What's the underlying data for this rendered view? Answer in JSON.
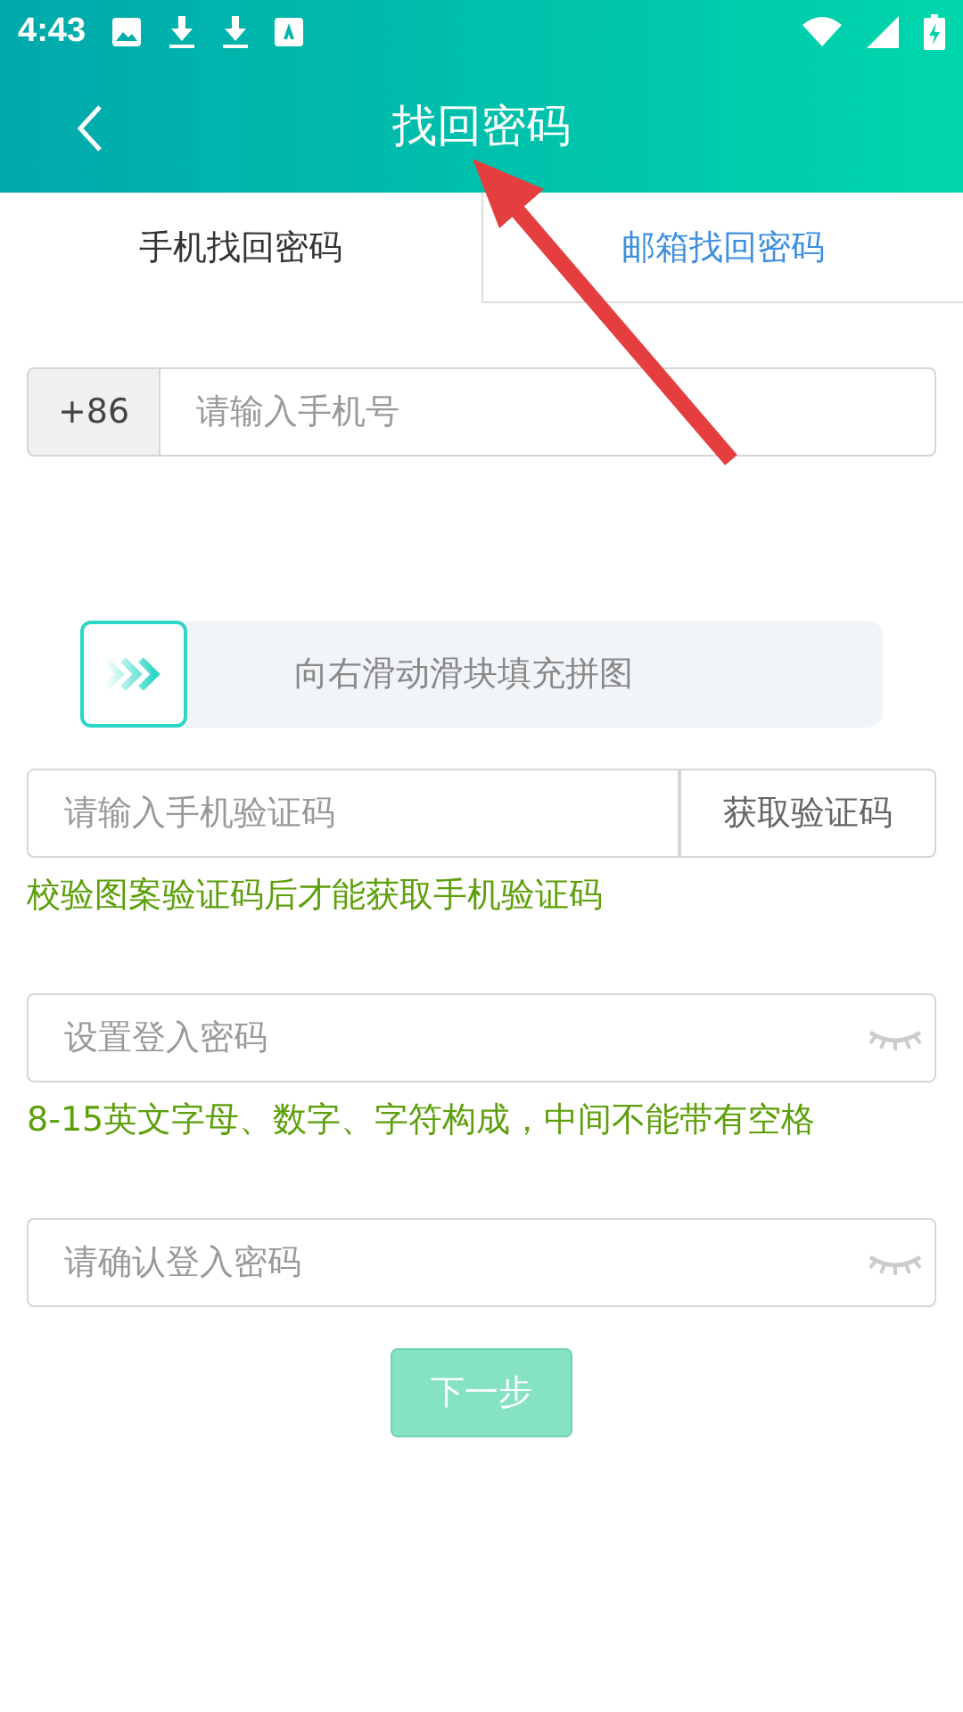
{
  "status_bar": {
    "time": "4:43"
  },
  "toolbar": {
    "title": "找回密码"
  },
  "tabs": [
    {
      "label": "手机找回密码",
      "selected": true
    },
    {
      "label": "邮箱找回密码",
      "selected": false
    }
  ],
  "phone": {
    "prefix": "+86",
    "placeholder": "请输入手机号"
  },
  "slider": {
    "label": "向右滑动滑块填充拼图",
    "level": 0
  },
  "sms_code": {
    "placeholder": "请输入手机验证码",
    "button": "获取验证码"
  },
  "sms_hint": "校验图案验证码后才能获取手机验证码",
  "password": {
    "placeholder": "设置登入密码",
    "masked": true
  },
  "password_hint": "8-15英文字母、数字、字符构成，中间不能带有空格",
  "confirm_password": {
    "placeholder": "请确认登入密码",
    "masked": true
  },
  "next_button": {
    "label": "下一步",
    "disabled": true
  }
}
